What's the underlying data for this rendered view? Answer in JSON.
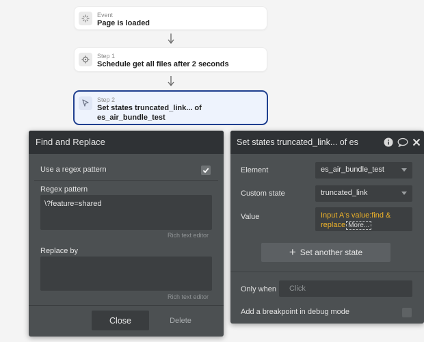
{
  "workflow": {
    "event": {
      "caption": "Event",
      "title": "Page is loaded"
    },
    "step1": {
      "caption": "Step 1",
      "title": "Schedule get all files after 2 seconds"
    },
    "step2": {
      "caption": "Step 2",
      "title_line1": "Set states truncated_link... of",
      "title_line2": "es_air_bundle_test"
    }
  },
  "find_replace": {
    "title": "Find and Replace",
    "regex_toggle_label": "Use a regex pattern",
    "regex_enabled": true,
    "regex_pattern_label": "Regex pattern",
    "regex_pattern_value": "\\?feature=shared",
    "rich_text_editor_1": "Rich text editor",
    "replace_by_label": "Replace by",
    "replace_by_value": "",
    "rich_text_editor_2": "Rich text editor",
    "close_label": "Close",
    "delete_label": "Delete"
  },
  "set_states": {
    "title": "Set states truncated_link... of es",
    "element_label": "Element",
    "element_value": "es_air_bundle_test",
    "custom_state_label": "Custom state",
    "custom_state_value": "truncated_link",
    "value_label": "Value",
    "value_expr_line1": "Input A's value:find &",
    "value_expr_line2": "replace",
    "value_more": "More...",
    "add_state_label": "Set another state",
    "only_when_label": "Only when",
    "only_when_placeholder": "Click",
    "breakpoint_label": "Add a breakpoint in debug mode",
    "colors": {
      "expression": "#f0b429",
      "accent_selected": "#1f3f8f"
    }
  }
}
